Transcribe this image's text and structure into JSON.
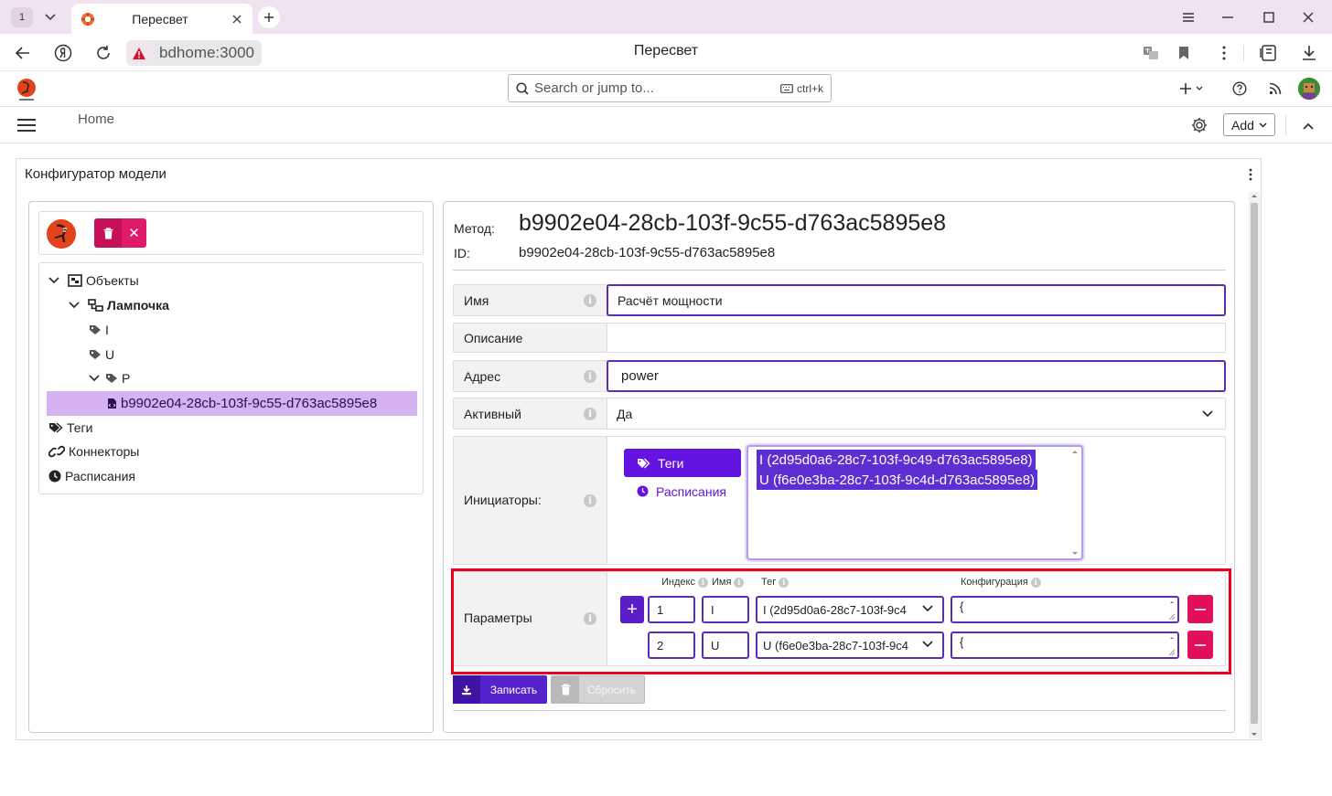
{
  "browser": {
    "tab_count": "1",
    "tab_title": "Пересвет",
    "url": "bdhome:3000",
    "page_title": "Пересвет"
  },
  "app": {
    "search_placeholder": "Search or jump to...",
    "search_shortcut": "ctrl+k",
    "breadcrumb_home": "Home",
    "add_label": "Add"
  },
  "portlet": {
    "title": "Конфигуратор модели"
  },
  "tree": {
    "nodes": [
      {
        "label": "Объекты",
        "icon": "objects-icon"
      },
      {
        "label": "Лампочка",
        "icon": "device-icon"
      },
      {
        "label": "I",
        "icon": "tag-icon"
      },
      {
        "label": "U",
        "icon": "tag-icon"
      },
      {
        "label": "P",
        "icon": "tag-icon"
      },
      {
        "label": "b9902e04-28cb-103f-9c55-d763ac5895e8",
        "icon": "method-icon"
      },
      {
        "label": "Теги",
        "icon": "tags-icon"
      },
      {
        "label": "Коннекторы",
        "icon": "link-icon"
      },
      {
        "label": "Расписания",
        "icon": "clock-icon"
      }
    ]
  },
  "method": {
    "label": "Метод:",
    "value": "b9902e04-28cb-103f-9c55-d763ac5895e8",
    "id_label": "ID:",
    "id_value": "b9902e04-28cb-103f-9c55-d763ac5895e8"
  },
  "form": {
    "name_label": "Имя",
    "name_value": "Расчёт мощности",
    "desc_label": "Описание",
    "desc_value": "",
    "address_label": "Адрес",
    "address_value": "power",
    "active_label": "Активный",
    "active_value": "Да",
    "initiators_label": "Инициаторы:",
    "initiators_tab_tags": "Теги",
    "initiators_tab_schedules": "Расписания",
    "initiators_selected": [
      "I (2d95d0a6-28c7-103f-9c49-d763ac5895e8)",
      "U (f6e0e3ba-28c7-103f-9c4d-d763ac5895e8)"
    ],
    "params_label": "Параметры",
    "params_headers": {
      "index": "Индекс",
      "name": "Имя",
      "tag": "Тег",
      "config": "Конфигурация"
    },
    "params": [
      {
        "index": "1",
        "name": "I",
        "tag": "I (2d95d0a6-28c7-103f-9c4",
        "config": "{"
      },
      {
        "index": "2",
        "name": "U",
        "tag": "U (f6e0e3ba-28c7-103f-9c4",
        "config": "{"
      }
    ]
  },
  "actions": {
    "save": "Записать",
    "reset": "Сбросить"
  },
  "colors": {
    "accent": "#6314e0",
    "danger": "#e0105a",
    "highlight": "#e8001c"
  }
}
